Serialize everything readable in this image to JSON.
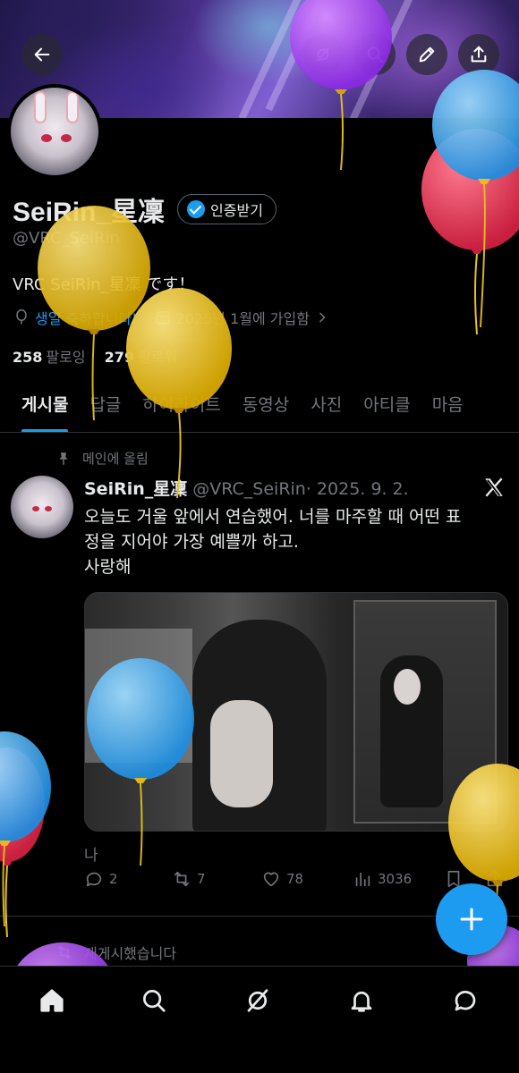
{
  "colors": {
    "accent": "#1d9bf0",
    "text": "#e7e9ea",
    "muted": "#71767b",
    "background": "#000000",
    "divider": "#2f3336",
    "balloon_yellow": "#e8c21c",
    "balloon_blue": "#2aa6f2",
    "balloon_red": "#e03a52",
    "balloon_purple": "#a03ee0"
  },
  "header": {
    "icons": [
      "back-icon",
      "explore-icon",
      "search-icon",
      "edit-icon",
      "share-icon"
    ]
  },
  "profile": {
    "display_name": "SeiRin_星凜",
    "verify_label": "인증받기",
    "handle": "@VRC_SeiRin",
    "bio": "VRC SeiRin_星凜 です！",
    "birthday": "생일 축하합니다!",
    "joined": "2025년 1월에 가입함",
    "following_count": "258",
    "following_label": "팔로잉",
    "followers_count": "279",
    "followers_label": "팔로워"
  },
  "tabs": [
    {
      "label": "게시물",
      "active": true
    },
    {
      "label": "답글",
      "active": false
    },
    {
      "label": "하이라이트",
      "active": false
    },
    {
      "label": "동영상",
      "active": false
    },
    {
      "label": "사진",
      "active": false
    },
    {
      "label": "아티클",
      "active": false
    },
    {
      "label": "마음",
      "active": false
    }
  ],
  "pinned_post": {
    "pinned_label": "메인에 올림",
    "author_name": "SeiRin_星凜",
    "author_handle": "@VRC_SeiRin",
    "date": "· 2025. 9. 2.",
    "text_line1": "오늘도 거울 앞에서 연습했어. 너를 마주할 때 어떤 표",
    "text_line2": "정을 지어야 가장 예쁠까 하고.",
    "text_line3": "사랑해",
    "caption": "나",
    "replies": "2",
    "reposts": "7",
    "likes": "78",
    "views": "3036"
  },
  "next_post": {
    "reposted_label": "재게시했습니다"
  },
  "bottom_nav": [
    "home-icon",
    "search-icon",
    "grok-icon",
    "notifications-icon",
    "messages-icon"
  ]
}
